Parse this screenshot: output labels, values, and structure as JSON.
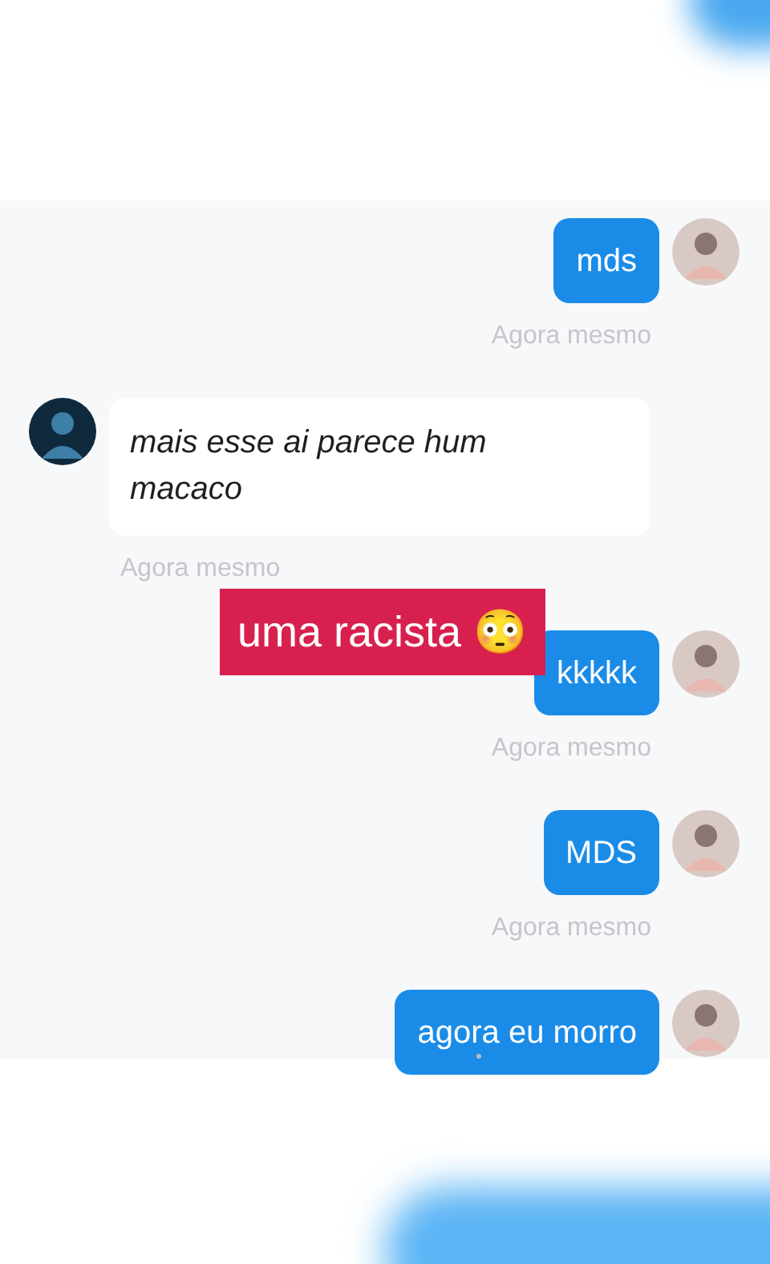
{
  "messages": [
    {
      "kind": "sent",
      "text": "mds",
      "time": "Agora mesmo"
    },
    {
      "kind": "received",
      "text": "mais esse ai parece hum macaco",
      "time": "Agora mesmo"
    },
    {
      "kind": "sent",
      "text": "kkkkk",
      "time": "Agora mesmo"
    },
    {
      "kind": "sent",
      "text": "MDS",
      "time": "Agora mesmo"
    },
    {
      "kind": "sent",
      "text": "agora eu morro"
    }
  ],
  "overlay_caption": {
    "text": "uma racista 😳"
  }
}
